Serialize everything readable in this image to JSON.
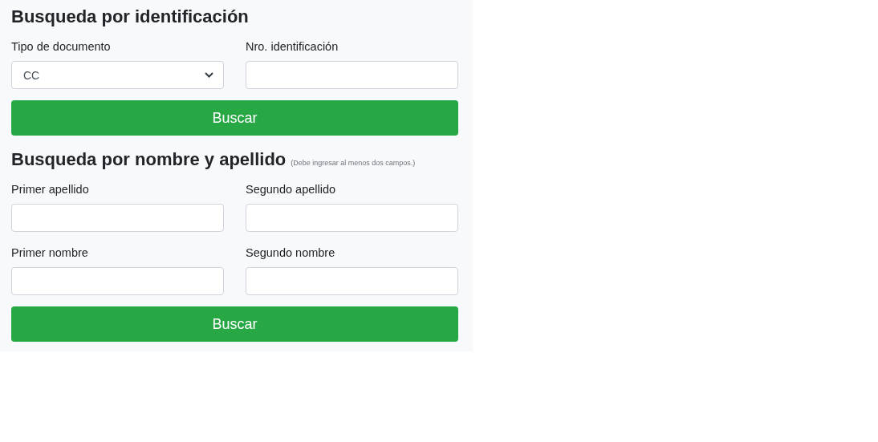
{
  "sections": [
    {
      "title": "Busqueda por identificación",
      "fields": [
        {
          "kind": "select",
          "label": "Tipo de documento",
          "value": "CC"
        },
        {
          "kind": "text",
          "label": "Nro. identificación"
        }
      ],
      "button": "Buscar"
    },
    {
      "title": "Busqueda por nombre y apellido",
      "note": "(Debe ingresar al menos dos campos.)",
      "fields": [
        {
          "kind": "text",
          "label": "Primer apellido"
        },
        {
          "kind": "text",
          "label": "Segundo apellido"
        },
        {
          "kind": "text",
          "label": "Primer nombre"
        },
        {
          "kind": "text",
          "label": "Segundo nombre"
        }
      ],
      "button": "Buscar"
    }
  ]
}
